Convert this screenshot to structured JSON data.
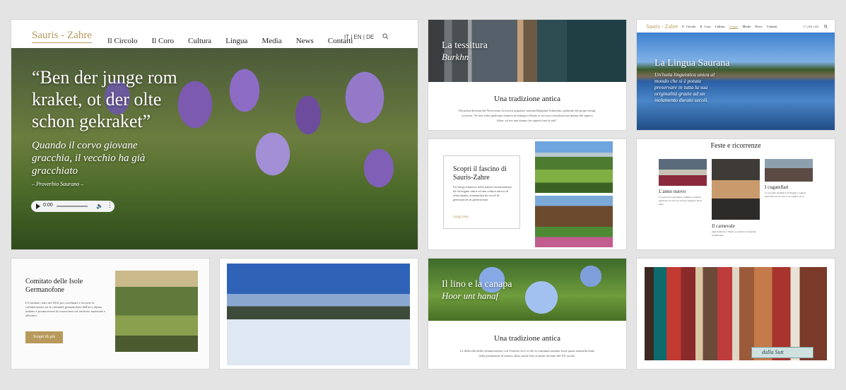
{
  "hero": {
    "logo": "Sauris - Zahre",
    "nav": [
      "Il Circolo",
      "Il Coro",
      "Cultura",
      "Lingua",
      "Media",
      "News",
      "Contatti"
    ],
    "languages": [
      "IT",
      "EN",
      "DE"
    ],
    "quote": "“Ben der junge rom kraket, ot der olte schon gekraket”",
    "translation": "Quando il corvo giovane gracchia, il vecchio ha già gracchiato",
    "attribution": "– Proverbio Saurano –",
    "audio_time": "0:00"
  },
  "tessitura": {
    "title": "La tessitura",
    "subtitle": "Burkhn",
    "heading": "Una tradizione antica",
    "body": "Nei primi decenni del Novecento la ricerca popolare saurana Bulgenta Schneider, parlando dei propri tempi, scriveva \"Se una volta qualcuno entrava in bottega a Sauris si trovava a tessitura una donna che sapeva filare, ed era una donna che sapeva fare la tela\"."
  },
  "lingua": {
    "logo": "Sauris - Zahre",
    "nav": [
      "Il Circolo",
      "Il Coro",
      "Cultura",
      "Lingua",
      "Media",
      "News",
      "Contatti"
    ],
    "languages": [
      "IT",
      "EN",
      "DE"
    ],
    "title": "La Lingua Saurana",
    "text": "Un'isola linguistica unica al mondo che si è potuta preservare in tutta la sua originalità grazie ad un isolamento durato secoli."
  },
  "fascino": {
    "title": "Scopri il fascino di Sauris-Zahre",
    "body": "Un borgo immerso nella natura incontaminata da un'origine unica ed una cultura antica ed affascinante, tramandata da secoli di generazione in generazione.",
    "link": "Leggi tutto"
  },
  "feste": {
    "title": "Feste e ricorrenze",
    "items": [
      {
        "title": "L'anno nuovo",
        "text": "La notte del capodanno, bambini e ragazzi andavano di casa in casa per augurare buon anno."
      },
      {
        "title": "Il carnevale",
        "text": "Ogni febbraio a Sauris si celebra il carnevale tradizionale."
      },
      {
        "title": "I cugatellari",
        "text": "La seconda domenica di maggio i ragazzi andavano per le case a raccogliere uova."
      }
    ]
  },
  "comitato": {
    "title": "Comitato delle Isole Germanofone",
    "body": "Il Comitato, nato nel 2012 per coordinare e favorire la collaborazione tra le comunità germanofone dell'arco alpino italiano e promuoverne la conoscenza sul territorio nazionale e all'estero.",
    "button": "Scopri di più"
  },
  "lino": {
    "title": "Il lino e la canapa",
    "subtitle": "Hoor unt hanaf",
    "heading": "Una tradizione antica",
    "body": "Le difficoltà della comunicazione con l'esterno fece sì che la comunità saurana fosse quasi autosufficiente nella produzione di tessuti, abiti, anche fino ai primi decenni del XX secolo."
  },
  "spools": {
    "sign": "dalla Sutt"
  }
}
